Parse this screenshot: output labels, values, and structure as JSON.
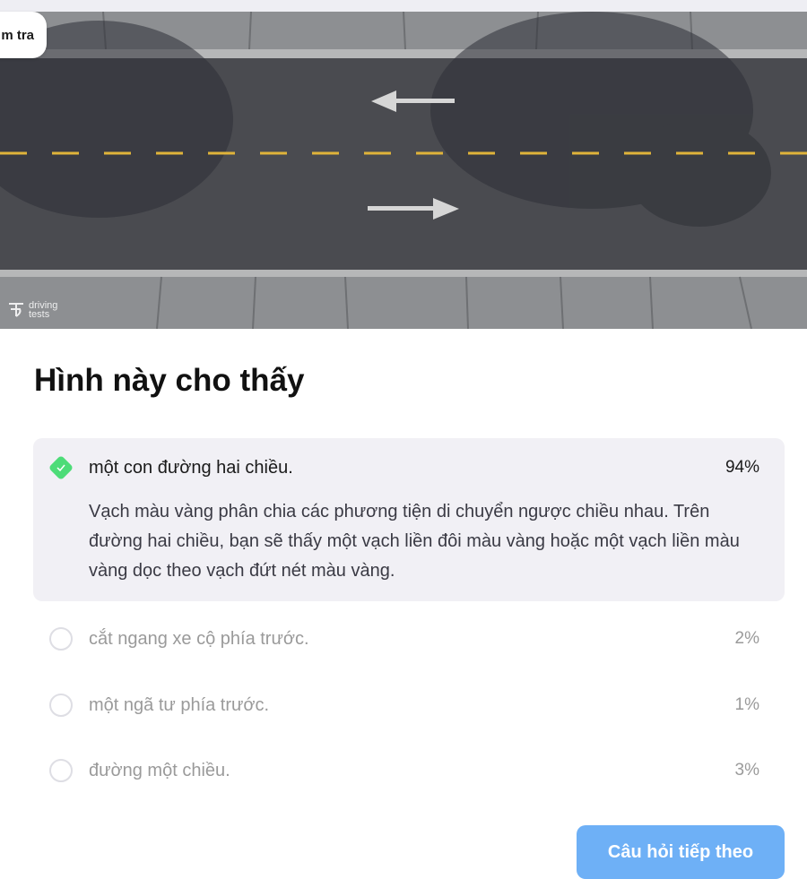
{
  "top_chip": {
    "text": "m tra"
  },
  "hero": {
    "watermark_line1": "driving",
    "watermark_line2": "tests"
  },
  "question": {
    "title": "Hình này cho thấy"
  },
  "answers": [
    {
      "label": "một con đường hai chiều.",
      "percent": "94%",
      "state": "correct",
      "explanation": "Vạch màu vàng phân chia các phương tiện di chuyển ngược chiều nhau. Trên đường hai chiều, bạn sẽ thấy một vạch liền đôi màu vàng hoặc một vạch liền màu vàng dọc theo vạch đứt nét màu vàng."
    },
    {
      "label": "cắt ngang xe cộ phía trước.",
      "percent": "2%",
      "state": "unselected"
    },
    {
      "label": "một ngã tư phía trước.",
      "percent": "1%",
      "state": "unselected"
    },
    {
      "label": "đường một chiều.",
      "percent": "3%",
      "state": "unselected"
    }
  ],
  "next_button": {
    "label": "Câu hỏi tiếp theo"
  },
  "colors": {
    "accent_correct": "#4ddc78",
    "button_bg": "#6eb0f6",
    "selected_bg": "#f1f0f5",
    "lane_line": "#e0b43a"
  }
}
